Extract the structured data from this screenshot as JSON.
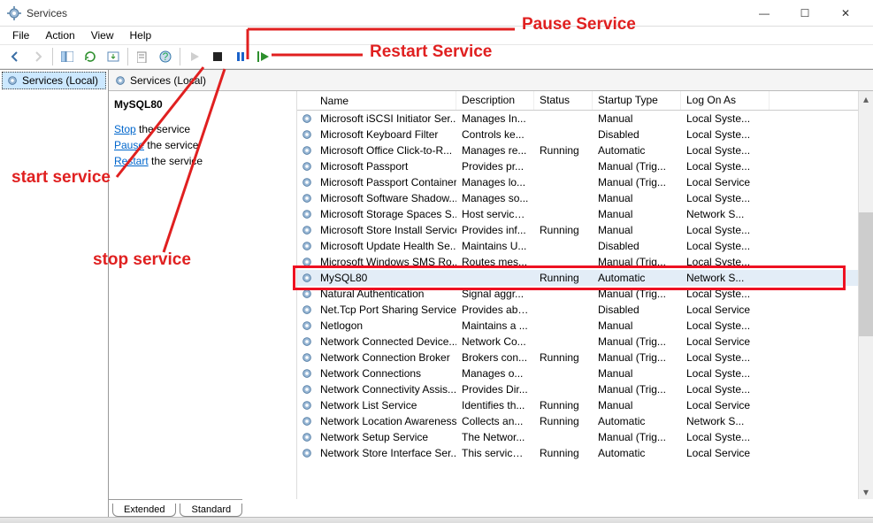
{
  "window": {
    "title": "Services"
  },
  "win_controls": {
    "min": "—",
    "max": "☐",
    "close": "✕"
  },
  "menu": {
    "file": "File",
    "action": "Action",
    "view": "View",
    "help": "Help"
  },
  "toolbar_icons": {
    "back": "←",
    "forward": "→",
    "up": "",
    "show_hide": "",
    "props": "",
    "export": "",
    "help_btn": "?",
    "play": "▶",
    "stop": "■",
    "pause": "❚❚",
    "restart": "|▶"
  },
  "tree": {
    "root": "Services (Local)"
  },
  "pane_head": "Services (Local)",
  "selected": {
    "name": "MySQL80",
    "stop_word": "Stop",
    "stop_rest": " the service",
    "pause_word": "Pause",
    "pause_rest": " the service",
    "restart_word": "Restart",
    "restart_rest": " the service"
  },
  "columns": {
    "name": "Name",
    "desc": "Description",
    "status": "Status",
    "startup": "Startup Type",
    "logon": "Log On As"
  },
  "rows": [
    {
      "name": "Microsoft iSCSI Initiator Ser...",
      "desc": "Manages In...",
      "status": "",
      "startup": "Manual",
      "logon": "Local Syste..."
    },
    {
      "name": "Microsoft Keyboard Filter",
      "desc": "Controls ke...",
      "status": "",
      "startup": "Disabled",
      "logon": "Local Syste..."
    },
    {
      "name": "Microsoft Office Click-to-R...",
      "desc": "Manages re...",
      "status": "Running",
      "startup": "Automatic",
      "logon": "Local Syste..."
    },
    {
      "name": "Microsoft Passport",
      "desc": "Provides pr...",
      "status": "",
      "startup": "Manual (Trig...",
      "logon": "Local Syste..."
    },
    {
      "name": "Microsoft Passport Container",
      "desc": "Manages lo...",
      "status": "",
      "startup": "Manual (Trig...",
      "logon": "Local Service"
    },
    {
      "name": "Microsoft Software Shadow...",
      "desc": "Manages so...",
      "status": "",
      "startup": "Manual",
      "logon": "Local Syste..."
    },
    {
      "name": "Microsoft Storage Spaces S...",
      "desc": "Host service...",
      "status": "",
      "startup": "Manual",
      "logon": "Network S..."
    },
    {
      "name": "Microsoft Store Install Service",
      "desc": "Provides inf...",
      "status": "Running",
      "startup": "Manual",
      "logon": "Local Syste..."
    },
    {
      "name": "Microsoft Update Health Se...",
      "desc": "Maintains U...",
      "status": "",
      "startup": "Disabled",
      "logon": "Local Syste..."
    },
    {
      "name": "Microsoft Windows SMS Ro...",
      "desc": "Routes mes...",
      "status": "",
      "startup": "Manual (Trig...",
      "logon": "Local Syste..."
    },
    {
      "name": "MySQL80",
      "desc": "",
      "status": "Running",
      "startup": "Automatic",
      "logon": "Network S...",
      "highlight": true,
      "selected": true
    },
    {
      "name": "Natural Authentication",
      "desc": "Signal aggr...",
      "status": "",
      "startup": "Manual (Trig...",
      "logon": "Local Syste..."
    },
    {
      "name": "Net.Tcp Port Sharing Service",
      "desc": "Provides abi...",
      "status": "",
      "startup": "Disabled",
      "logon": "Local Service"
    },
    {
      "name": "Netlogon",
      "desc": "Maintains a ...",
      "status": "",
      "startup": "Manual",
      "logon": "Local Syste..."
    },
    {
      "name": "Network Connected Device...",
      "desc": "Network Co...",
      "status": "",
      "startup": "Manual (Trig...",
      "logon": "Local Service"
    },
    {
      "name": "Network Connection Broker",
      "desc": "Brokers con...",
      "status": "Running",
      "startup": "Manual (Trig...",
      "logon": "Local Syste..."
    },
    {
      "name": "Network Connections",
      "desc": "Manages o...",
      "status": "",
      "startup": "Manual",
      "logon": "Local Syste..."
    },
    {
      "name": "Network Connectivity Assis...",
      "desc": "Provides Dir...",
      "status": "",
      "startup": "Manual (Trig...",
      "logon": "Local Syste..."
    },
    {
      "name": "Network List Service",
      "desc": "Identifies th...",
      "status": "Running",
      "startup": "Manual",
      "logon": "Local Service"
    },
    {
      "name": "Network Location Awareness",
      "desc": "Collects an...",
      "status": "Running",
      "startup": "Automatic",
      "logon": "Network S..."
    },
    {
      "name": "Network Setup Service",
      "desc": "The Networ...",
      "status": "",
      "startup": "Manual (Trig...",
      "logon": "Local Syste..."
    },
    {
      "name": "Network Store Interface Ser...",
      "desc": "This service ...",
      "status": "Running",
      "startup": "Automatic",
      "logon": "Local Service"
    }
  ],
  "tabs": {
    "extended": "Extended",
    "standard": "Standard"
  },
  "annotations": {
    "pause": "Pause Service",
    "restart": "Restart Service",
    "start": "start service",
    "stop": "stop service"
  }
}
